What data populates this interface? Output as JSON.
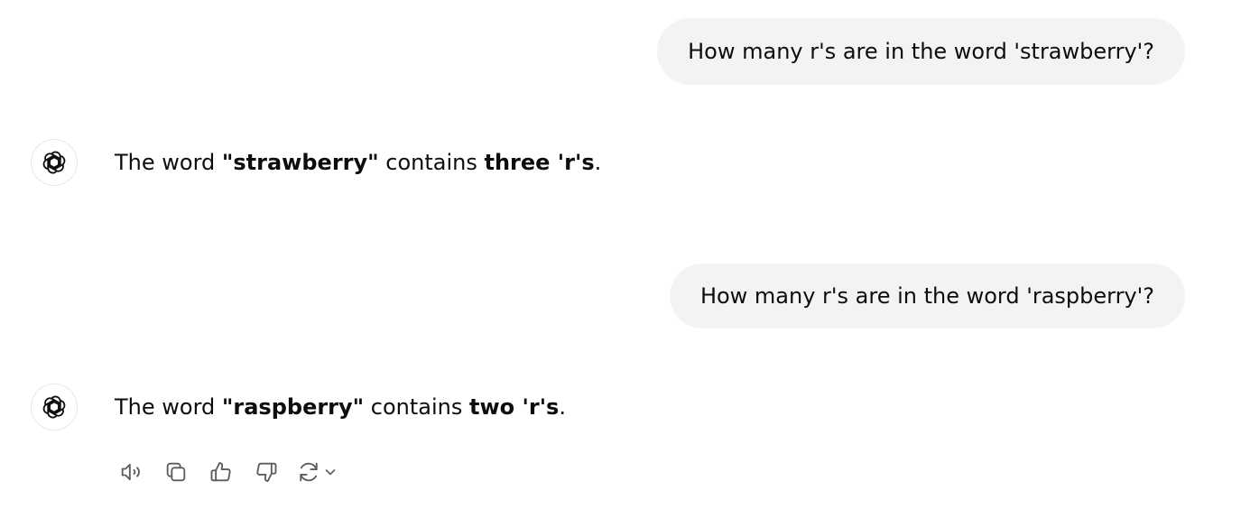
{
  "conversation": {
    "turns": [
      {
        "role": "user",
        "text": "How many r's are in the word 'strawberry'?"
      },
      {
        "role": "assistant",
        "parts": {
          "p1": "The word ",
          "b1": "\"strawberry\"",
          "p2": " contains ",
          "b2": "three 'r's",
          "p3": "."
        }
      },
      {
        "role": "user",
        "text": "How many r's are in the word 'raspberry'?"
      },
      {
        "role": "assistant",
        "parts": {
          "p1": "The word ",
          "b1": "\"raspberry\"",
          "p2": " contains ",
          "b2": "two 'r's",
          "p3": "."
        }
      }
    ]
  },
  "actions": {
    "icons": [
      "speaker-icon",
      "copy-icon",
      "thumbs-up-icon",
      "thumbs-down-icon",
      "regenerate-icon",
      "chevron-down-icon"
    ]
  },
  "colors": {
    "user_bubble_bg": "#f3f3f3",
    "text": "#0d0d0d",
    "icon": "#5d5d5d"
  }
}
